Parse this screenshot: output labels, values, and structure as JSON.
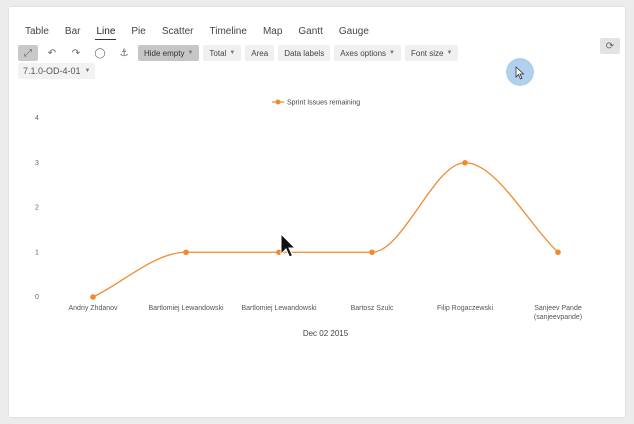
{
  "tabs": [
    "Table",
    "Bar",
    "Line",
    "Pie",
    "Scatter",
    "Timeline",
    "Map",
    "Gantt",
    "Gauge"
  ],
  "active_tab": "Line",
  "toolbar": {
    "hide_empty_label": "Hide empty",
    "total_label": "Total",
    "area_label": "Area",
    "data_labels_label": "Data labels",
    "axes_options_label": "Axes options",
    "font_size_label": "Font size"
  },
  "version_filter": {
    "value": "7.1.0-OD-4-01"
  },
  "colors": {
    "series": "#f08a30",
    "accent_circle": "#a9cbeb"
  },
  "chart_data": {
    "type": "line",
    "categories": [
      "Andriy Zhdanov",
      "Bartlomiej Lewandowski",
      "Bartlomiej Lewandowski",
      "Bartosz Szulc",
      "Filip Rogaczewski",
      "Sanjeev Pande (sanjeevpande)"
    ],
    "category_lines": [
      [
        "Andriy Zhdanov"
      ],
      [
        "Bartlomiej Lewandowski"
      ],
      [
        "Bartlomiej Lewandowski"
      ],
      [
        "Bartosz Szulc"
      ],
      [
        "Filip Rogaczewski"
      ],
      [
        "Sanjeev Pande",
        "(sanjeevpande)"
      ]
    ],
    "series": [
      {
        "name": "Sprint Issues remaining",
        "values": [
          0,
          1,
          1,
          1,
          3,
          1
        ]
      }
    ],
    "xlabel": "Dec 02 2015",
    "ylabel": "",
    "ylim": [
      0,
      4
    ],
    "yticks": [
      "0",
      "1",
      "2",
      "3",
      "4"
    ],
    "legend_position": "top-center",
    "smooth": true,
    "grid": false
  }
}
